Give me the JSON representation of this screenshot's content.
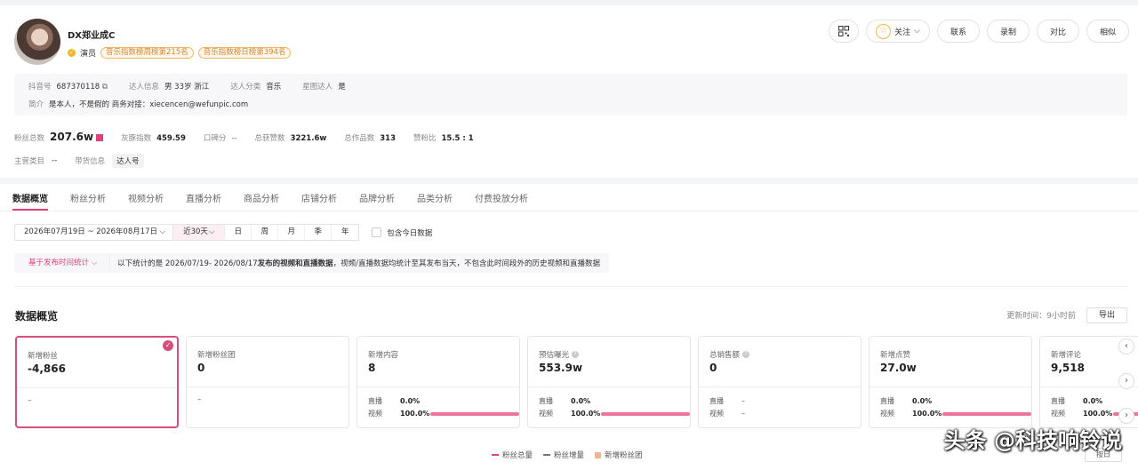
{
  "profile": {
    "name": "DX郑业成C",
    "role": "演员",
    "badges": [
      "音乐指数榜周榜第215名",
      "音乐指数榜日榜第394名"
    ]
  },
  "header_buttons": {
    "follow": "关注",
    "contact": "联系",
    "record": "录制",
    "compare": "对比",
    "similar": "相似"
  },
  "info": {
    "douyin_label": "抖音号",
    "douyin_value": "687370118",
    "talent_label": "达人信息",
    "talent_value": "男 33岁 浙江",
    "category_label": "达人分类",
    "category_value": "音乐",
    "star_label": "星图达人",
    "star_value": "是",
    "bio_label": "简介",
    "bio_value": "是本人，不是假的 商务对接：xiecencen@wefunpic.com"
  },
  "stats": [
    {
      "label": "粉丝总数",
      "value": "207.6w"
    },
    {
      "label": "灰豚指数",
      "value": "459.59"
    },
    {
      "label": "口碑分",
      "value": "--"
    },
    {
      "label": "总获赞数",
      "value": "3221.6w"
    },
    {
      "label": "总作品数",
      "value": "313"
    },
    {
      "label": "赞粉比",
      "value": "15.5 : 1"
    }
  ],
  "category_row": {
    "main_label": "主营类目",
    "main_value": "--",
    "goods_label": "带货信息",
    "goods_value": "达人号"
  },
  "tabs": [
    "数据概览",
    "粉丝分析",
    "视频分析",
    "直播分析",
    "商品分析",
    "店铺分析",
    "品牌分析",
    "品类分析",
    "付费投放分析"
  ],
  "filter": {
    "date_range": "2026年07月19日 ~ 2026年08月17日",
    "periods": [
      "近30天",
      "日",
      "周",
      "月",
      "季",
      "年"
    ],
    "include_today": "包含今日数据"
  },
  "notice": {
    "selector": "基于发布时间统计",
    "text_prefix": "以下统计的是 2026/07/19- 2026/08/17 ",
    "text_bold": "发布的视频和直播数据",
    "text_suffix": "，视频/直播数据均统计至其发布当天，不包含此时间段外的历史视频和直播数据"
  },
  "overview": {
    "title": "数据概览",
    "updated": "更新时间：9小时前",
    "export": "导出"
  },
  "cards": [
    {
      "label": "新增粉丝",
      "value": "-4,866",
      "dash": "–"
    },
    {
      "label": "新增粉丝团",
      "value": "0",
      "dash": "–"
    },
    {
      "label": "新增内容",
      "value": "8",
      "live": "0.0%",
      "video": "100.0%",
      "video_frac": 1.0
    },
    {
      "label": "预估曝光",
      "value": "553.9w",
      "live": "0.0%",
      "video": "100.0%",
      "video_frac": 1.0
    },
    {
      "label": "总销售额",
      "value": "0",
      "live": "–",
      "video": "–"
    },
    {
      "label": "新增点赞",
      "value": "27.0w",
      "live": "0.0%",
      "video": "100.0%",
      "video_frac": 1.0
    },
    {
      "label": "新增评论",
      "value": "9,518",
      "live": "0.0%",
      "video": "100.0%",
      "video_frac": 1.0
    }
  ],
  "card_sub": {
    "live": "直播",
    "video": "视频"
  },
  "legend": [
    "粉丝总量",
    "粉丝增量",
    "新增粉丝团"
  ],
  "watermark": "头条 @科技响铃说",
  "mini_button": "按日"
}
